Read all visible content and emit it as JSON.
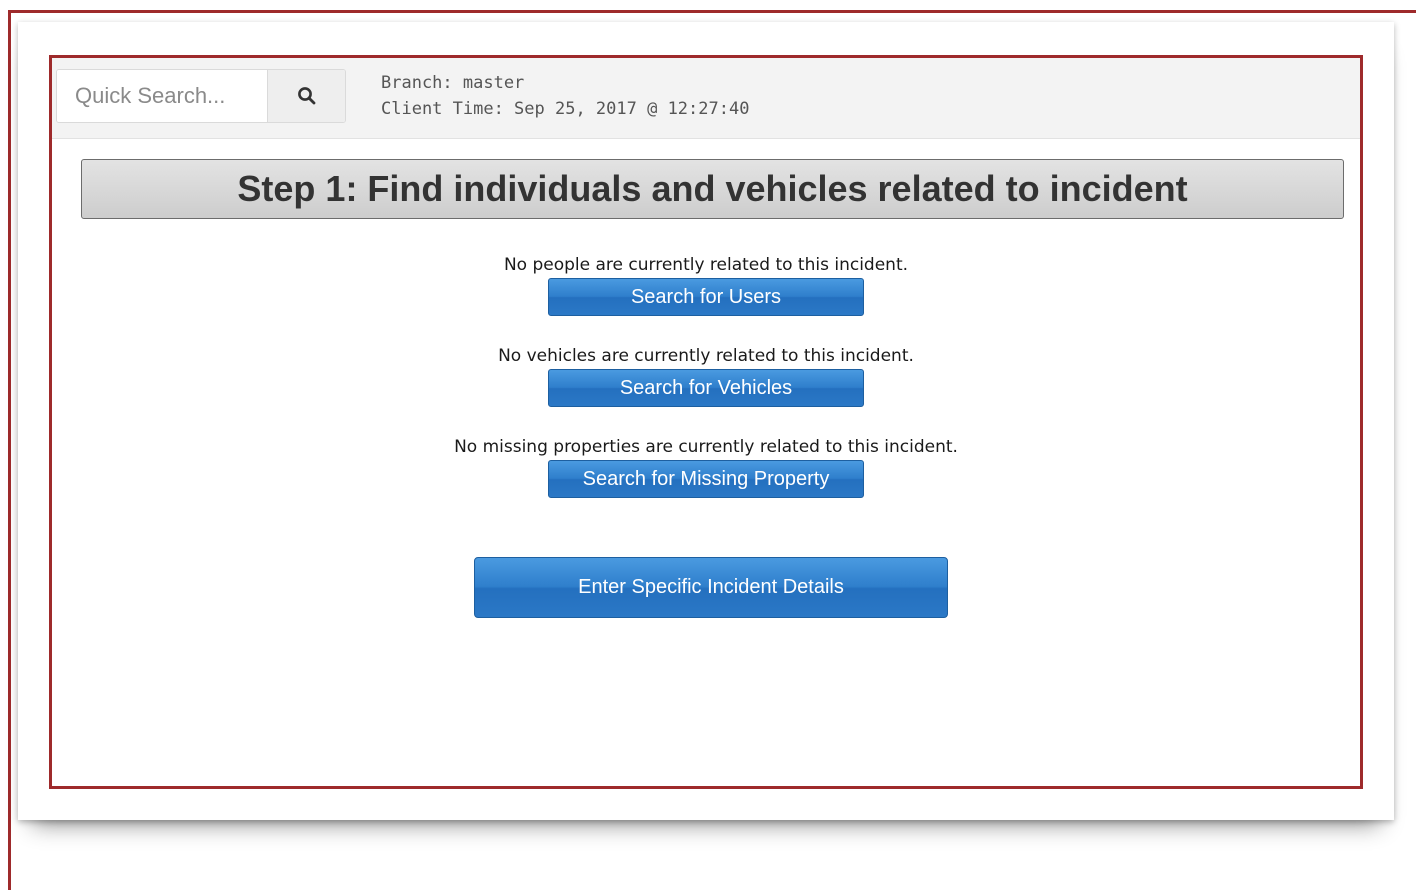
{
  "search": {
    "placeholder": "Quick Search...",
    "button_icon": "search-icon"
  },
  "meta": {
    "branch": "Branch: master",
    "client_time": "Client Time: Sep 25, 2017 @ 12:27:40"
  },
  "step": {
    "title": "Step 1: Find individuals and vehicles related to incident"
  },
  "sections": [
    {
      "message": "No people are currently related to this incident.",
      "button_label": "Search for Users"
    },
    {
      "message": "No vehicles are currently related to this incident.",
      "button_label": "Search for Vehicles"
    },
    {
      "message": "No missing properties are currently related to this incident.",
      "button_label": "Search for Missing Property"
    }
  ],
  "actions": {
    "enter_details_label": "Enter Specific Incident Details"
  },
  "colors": {
    "frame_border": "#9e2a2b",
    "button_blue": "#2b78c6",
    "banner_gray": "#d6d6d6"
  }
}
